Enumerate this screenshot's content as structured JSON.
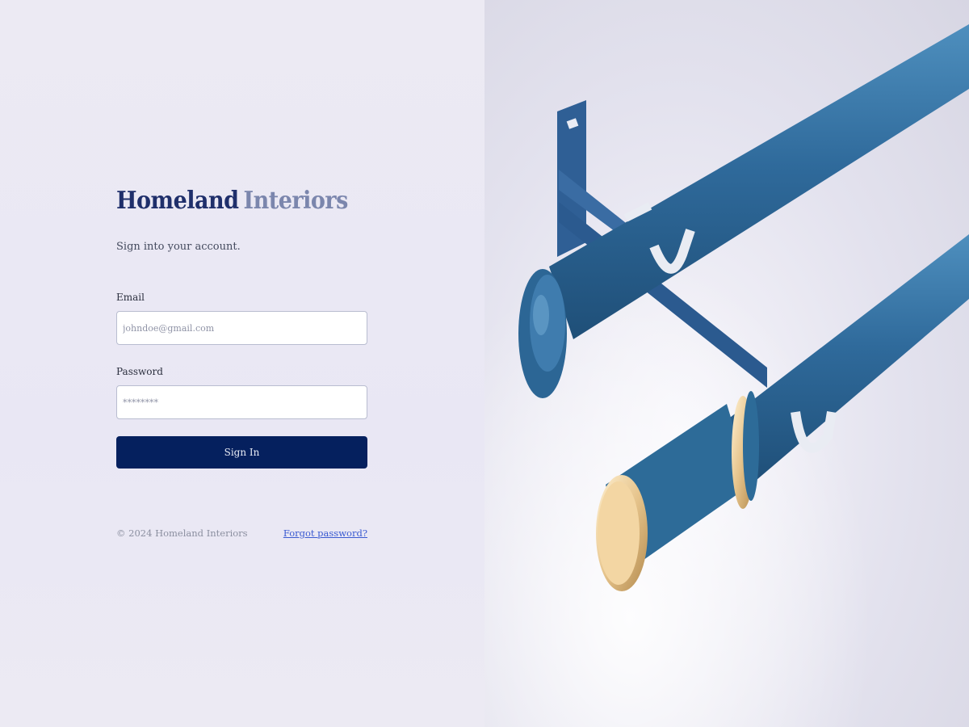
{
  "brand": {
    "primary": "Homeland",
    "secondary": "Interiors"
  },
  "login": {
    "subtitle": "Sign into your account.",
    "email": {
      "label": "Email",
      "placeholder": "johndoe@gmail.com",
      "value": ""
    },
    "password": {
      "label": "Password",
      "placeholder": "********",
      "value": ""
    },
    "submit_label": "Sign In"
  },
  "footer": {
    "copyright": "© 2024 Homeland Interiors",
    "forgot_password": "Forgot password?"
  },
  "hero": {
    "subject": "curtain-rod-image"
  },
  "colors": {
    "brand_primary": "#1f2f6b",
    "brand_secondary": "#7b86ad",
    "button_bg": "#05205e",
    "link": "#3a5ad1",
    "rod_blue": "#2f6a9b",
    "finial_gold": "#e6c48c"
  }
}
